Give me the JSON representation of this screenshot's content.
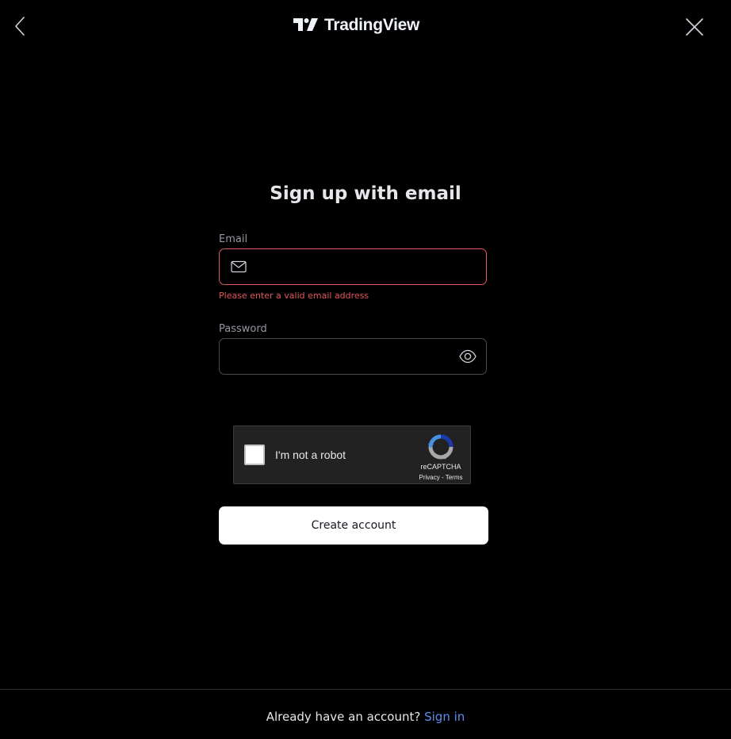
{
  "header": {
    "logo_text": "TradingView",
    "back_icon": "chevron-left-icon",
    "close_icon": "close-icon"
  },
  "form": {
    "title": "Sign up with email",
    "email": {
      "label": "Email",
      "value": "",
      "placeholder": "",
      "icon": "mail-icon",
      "error": "Please enter a valid email address"
    },
    "password": {
      "label": "Password",
      "value": "",
      "placeholder": "",
      "icon": "eye-icon"
    },
    "captcha": {
      "label": "I'm not a robot",
      "brand": "reCAPTCHA",
      "privacy": "Privacy",
      "separator": " - ",
      "terms": "Terms"
    },
    "submit_label": "Create account"
  },
  "footer": {
    "prompt": "Already have an account?",
    "link_label": "Sign in"
  },
  "colors": {
    "background": "#000000",
    "error": "#e0565a",
    "link": "#5b8def",
    "button_bg": "#ffffff"
  }
}
